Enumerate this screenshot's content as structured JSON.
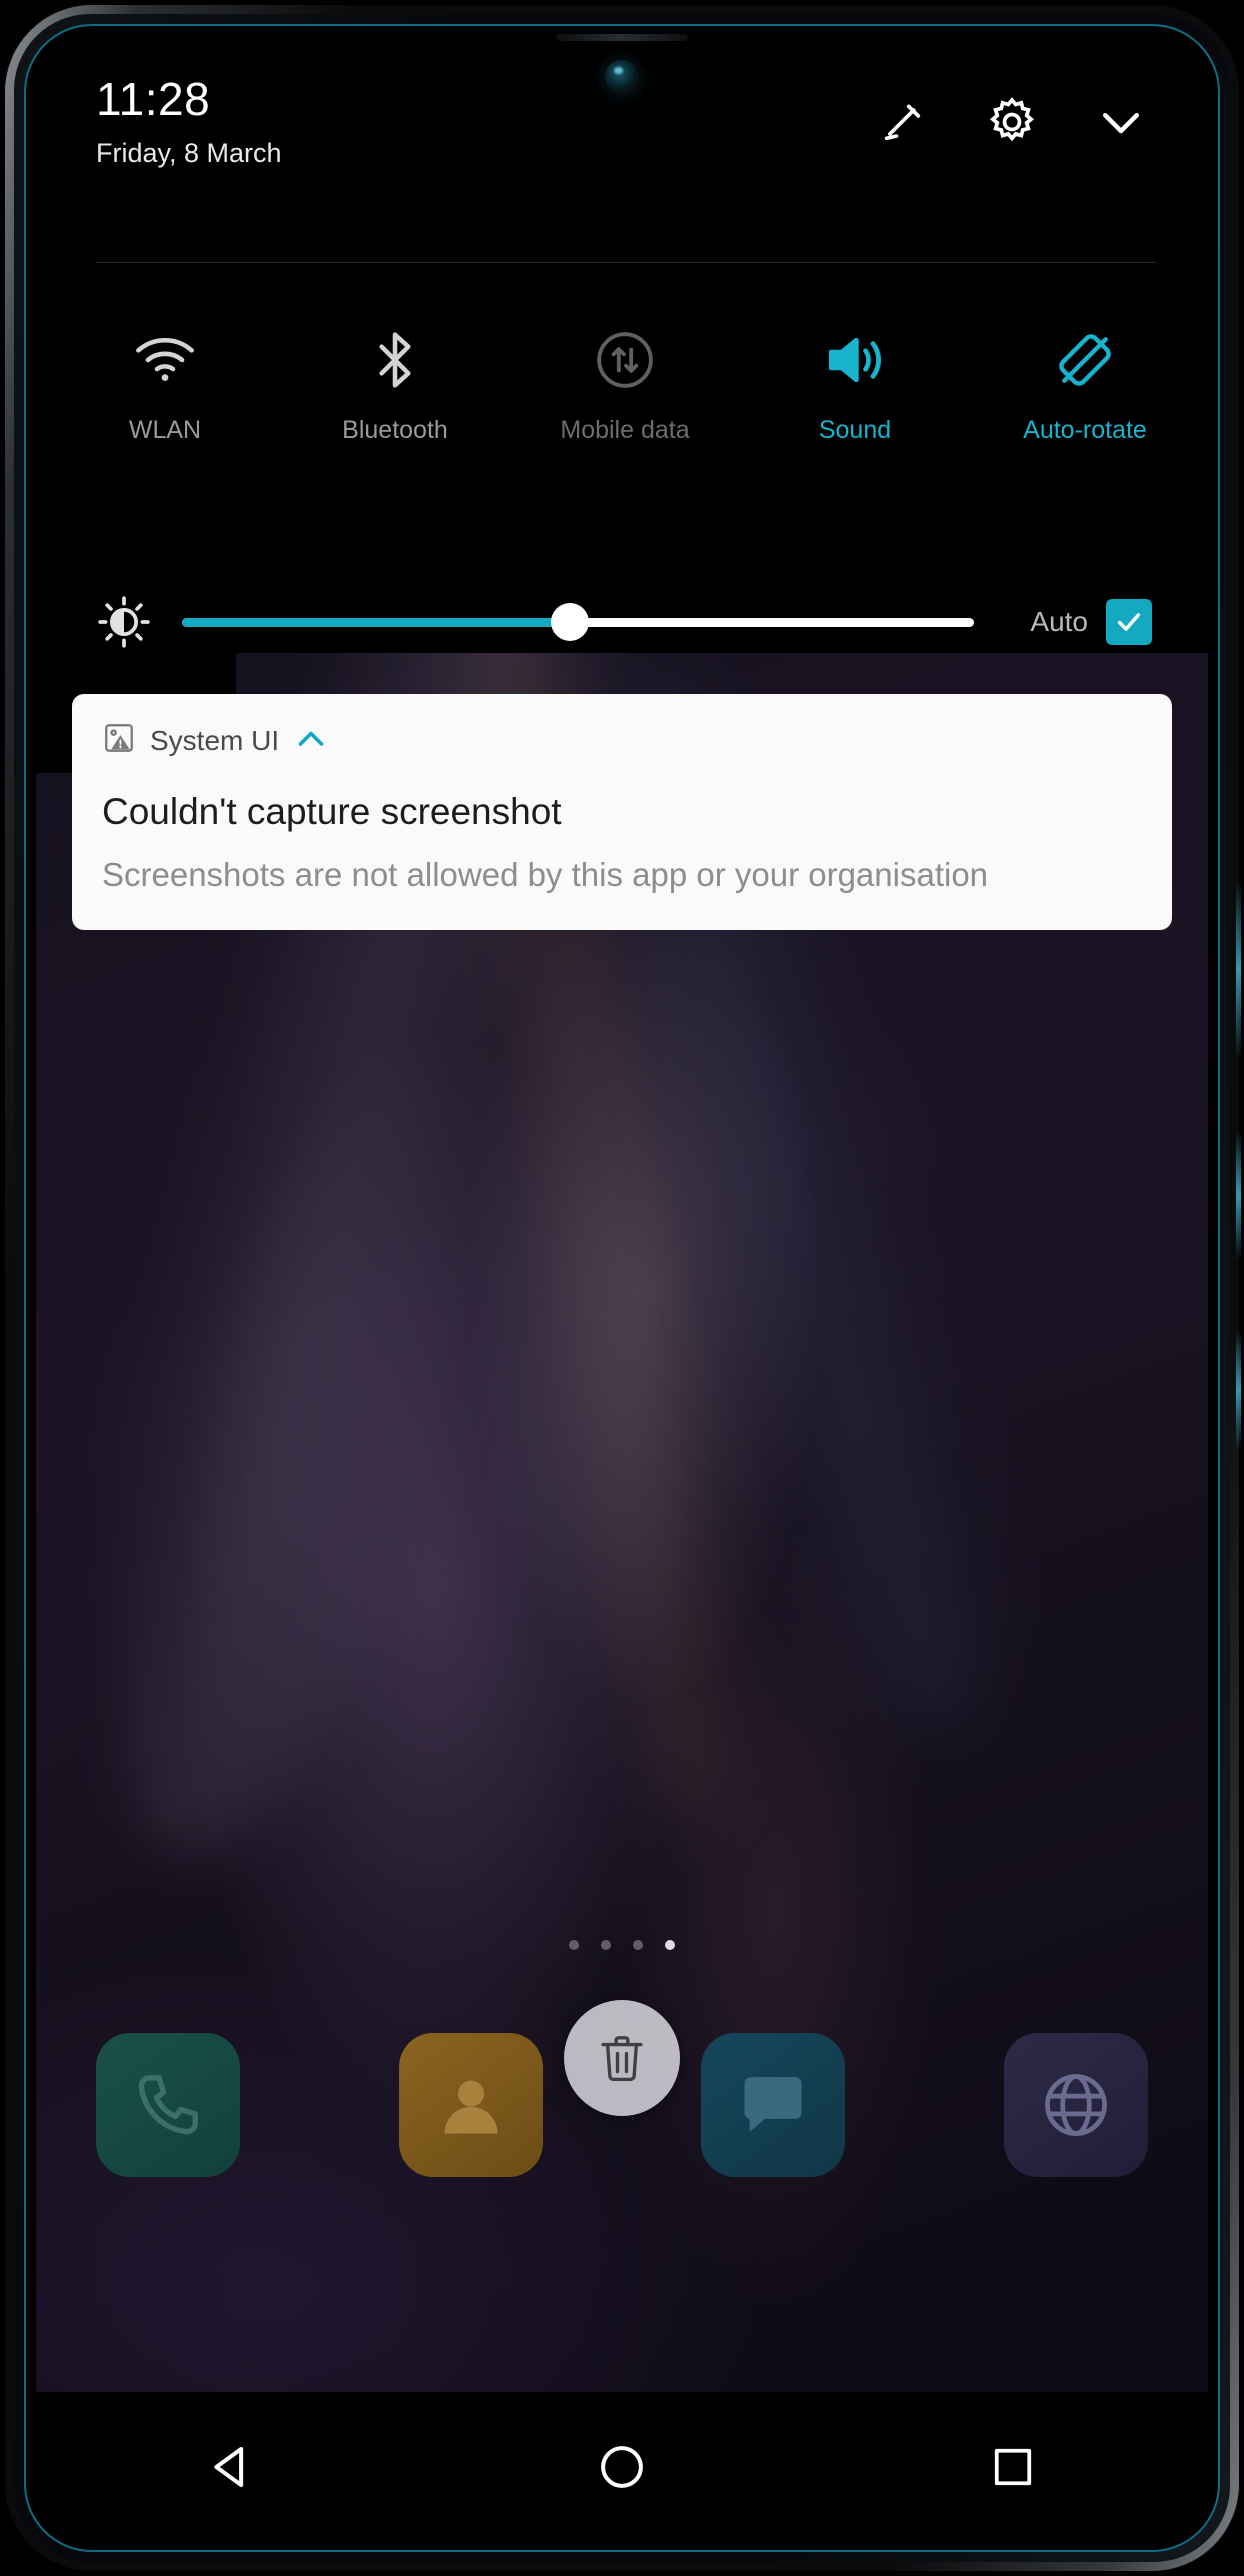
{
  "status": {
    "clock": "11:28",
    "date": "Friday, 8 March"
  },
  "header_icons": [
    {
      "name": "edit-icon",
      "label": "Edit"
    },
    {
      "name": "settings-gear-icon",
      "label": "Settings"
    },
    {
      "name": "chevron-down-icon",
      "label": "Collapse"
    }
  ],
  "quick_settings": {
    "tiles": [
      {
        "id": "wlan",
        "label": "WLAN",
        "icon": "wifi-icon",
        "state": "off"
      },
      {
        "id": "bluetooth",
        "label": "Bluetooth",
        "icon": "bluetooth-icon",
        "state": "off"
      },
      {
        "id": "mobile-data",
        "label": "Mobile data",
        "icon": "mobile-data-icon",
        "state": "disabled"
      },
      {
        "id": "sound",
        "label": "Sound",
        "icon": "volume-icon",
        "state": "on"
      },
      {
        "id": "auto-rotate",
        "label": "Auto-rotate",
        "icon": "rotate-icon",
        "state": "on"
      }
    ],
    "brightness": {
      "icon": "brightness-icon",
      "value_percent": 49,
      "auto_label": "Auto",
      "auto_checked": true
    }
  },
  "notification": {
    "app_icon": "image-warning-icon",
    "app_name": "System UI",
    "expand_icon": "chevron-up-icon",
    "title": "Couldn't capture screenshot",
    "body": "Screenshots are not allowed by this app or your organisation"
  },
  "home": {
    "page_dots": {
      "count": 4,
      "active_index": 3
    },
    "dock": [
      {
        "id": "phone",
        "label": "Phone",
        "icon": "phone-icon"
      },
      {
        "id": "contacts",
        "label": "Contacts",
        "icon": "contacts-icon"
      },
      {
        "id": "messages",
        "label": "Messages",
        "icon": "message-icon"
      },
      {
        "id": "browser",
        "label": "Browser",
        "icon": "globe-icon"
      }
    ],
    "drop_target": {
      "id": "remove",
      "label": "Remove",
      "icon": "trash-icon"
    }
  },
  "navbar": [
    {
      "id": "back",
      "label": "Back",
      "icon": "triangle-back-icon"
    },
    {
      "id": "home",
      "label": "Home",
      "icon": "circle-home-icon"
    },
    {
      "id": "recent",
      "label": "Recents",
      "icon": "square-recents-icon"
    }
  ],
  "colors": {
    "accent": "#13a9c0",
    "shade_bg": "#000000",
    "card_bg": "#fafafa",
    "label_inactive": "#9a9a9a"
  }
}
